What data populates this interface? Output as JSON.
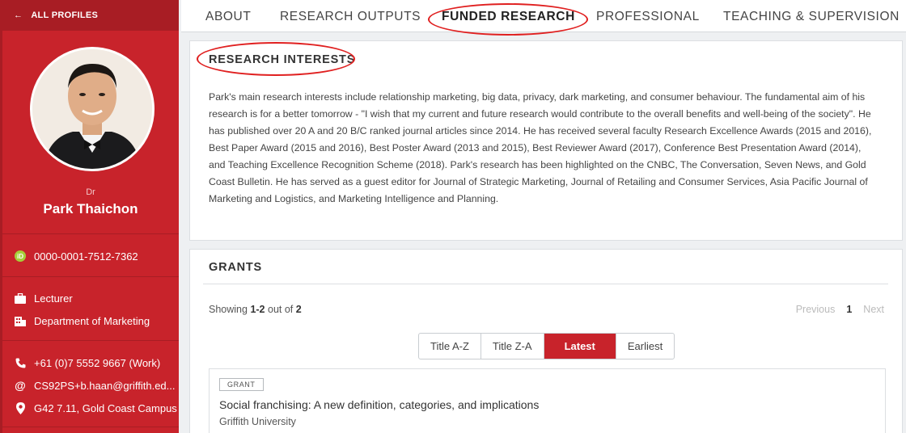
{
  "sidebar": {
    "back_label": "ALL PROFILES",
    "person_title": "Dr",
    "person_name": "Park Thaichon",
    "orcid": "0000-0001-7512-7362",
    "position": "Lecturer",
    "department": "Department of Marketing",
    "phone": "+61 (0)7 5552 9667 (Work)",
    "email": "CS92PS+b.haan@griffith.ed...",
    "location": "G42 7.11, Gold Coast Campus",
    "colors": {
      "primary": "#c8232b",
      "dark": "#a81d24",
      "orcid_green": "#a6ce39"
    }
  },
  "tabs": [
    {
      "label": "ABOUT"
    },
    {
      "label": "RESEARCH OUTPUTS"
    },
    {
      "label": "FUNDED RESEARCH"
    },
    {
      "label": "PROFESSIONAL"
    },
    {
      "label": "TEACHING & SUPERVISION"
    }
  ],
  "interests": {
    "heading": "RESEARCH INTERESTS",
    "body": "Park's main research interests include relationship marketing, big data, privacy, dark marketing, and consumer behaviour. The fundamental aim of his research is for a better tomorrow - \"I wish that my current and future research would contribute to the overall benefits and well-being of the society\". He has published over 20 A and 20 B/C ranked journal articles since 2014. He has received several faculty Research Excellence Awards (2015 and 2016), Best Paper Award (2015 and 2016), Best Poster Award (2013 and 2015), Best Reviewer Award (2017), Conference Best Presentation Award (2014), and Teaching Excellence Recognition Scheme (2018). Park's research has been highlighted on the CNBC, The Conversation, Seven News, and Gold Coast Bulletin. He has served as a guest editor for Journal of Strategic Marketing, Journal of Retailing and Consumer Services, Asia Pacific Journal of Marketing and Logistics, and Marketing Intelligence and Planning."
  },
  "grants": {
    "heading": "GRANTS",
    "showing_prefix": "Showing",
    "showing_range": "1-2",
    "showing_mid": "out of",
    "showing_total": "2",
    "pager": {
      "previous": "Previous",
      "current": "1",
      "next": "Next"
    },
    "sort_options": [
      "Title A-Z",
      "Title Z-A",
      "Latest",
      "Earliest"
    ],
    "sort_selected": "Latest",
    "items": [
      {
        "badge": "GRANT",
        "title": "Social franchising: A new definition, categories, and implications",
        "org": "Griffith University"
      }
    ]
  },
  "annotation_color": "#e02020"
}
